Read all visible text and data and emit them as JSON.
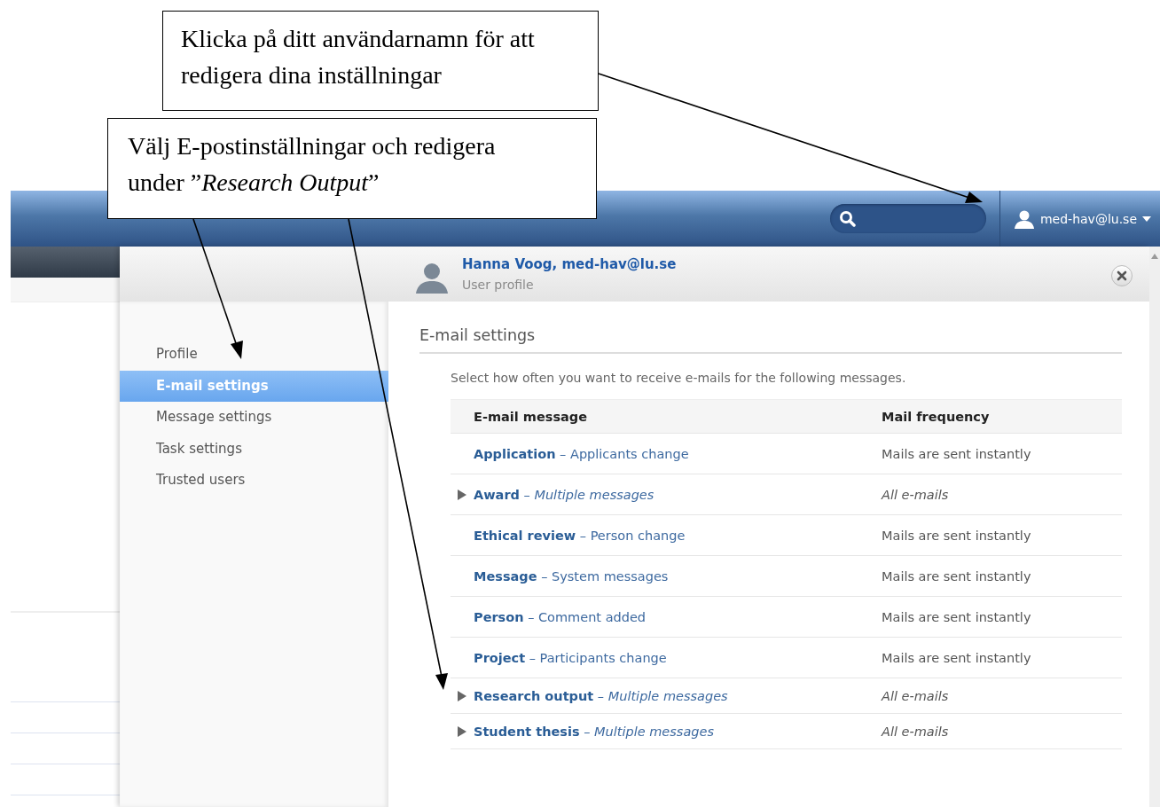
{
  "callouts": [
    {
      "text": "Klicka på ditt användarnamn för att redigera dina inställningar"
    },
    {
      "text": "Välj E-postinställningar och redigera under ”*Research Output*”"
    }
  ],
  "header": {
    "user": "med-hav@lu.se"
  },
  "profile": {
    "name": "Hanna Voog, med-hav@lu.se",
    "subtitle": "User profile"
  },
  "nav": [
    {
      "label": "Profile",
      "selected": false
    },
    {
      "label": "E-mail settings",
      "selected": true
    },
    {
      "label": "Message settings",
      "selected": false
    },
    {
      "label": "Task settings",
      "selected": false
    },
    {
      "label": "Trusted users",
      "selected": false
    }
  ],
  "content": {
    "title": "E-mail settings",
    "description": "Select how often you want to receive e-mails for the following messages.",
    "columns": [
      "E-mail message",
      "Mail frequency"
    ],
    "rows": [
      {
        "message": "**Application** – Applicants change",
        "frequency": "Mails are sent instantly",
        "expandable": false
      },
      {
        "message": "**Award** – *Multiple messages*",
        "frequency": "All e-mails",
        "expandable": true
      },
      {
        "message": "**Ethical review** – Person change",
        "frequency": "Mails are sent instantly",
        "expandable": false
      },
      {
        "message": "**Message** – System messages",
        "frequency": "Mails are sent instantly",
        "expandable": false
      },
      {
        "message": "**Person** – Comment added",
        "frequency": "Mails are sent instantly",
        "expandable": false
      },
      {
        "message": "**Project** – Participants change",
        "frequency": "Mails are sent instantly",
        "expandable": false
      },
      {
        "message": "**Research output** – *Multiple messages*",
        "frequency": "All e-mails",
        "expandable": true
      },
      {
        "message": "**Student thesis** – *Multiple messages*",
        "frequency": "All e-mails",
        "expandable": true
      }
    ]
  }
}
